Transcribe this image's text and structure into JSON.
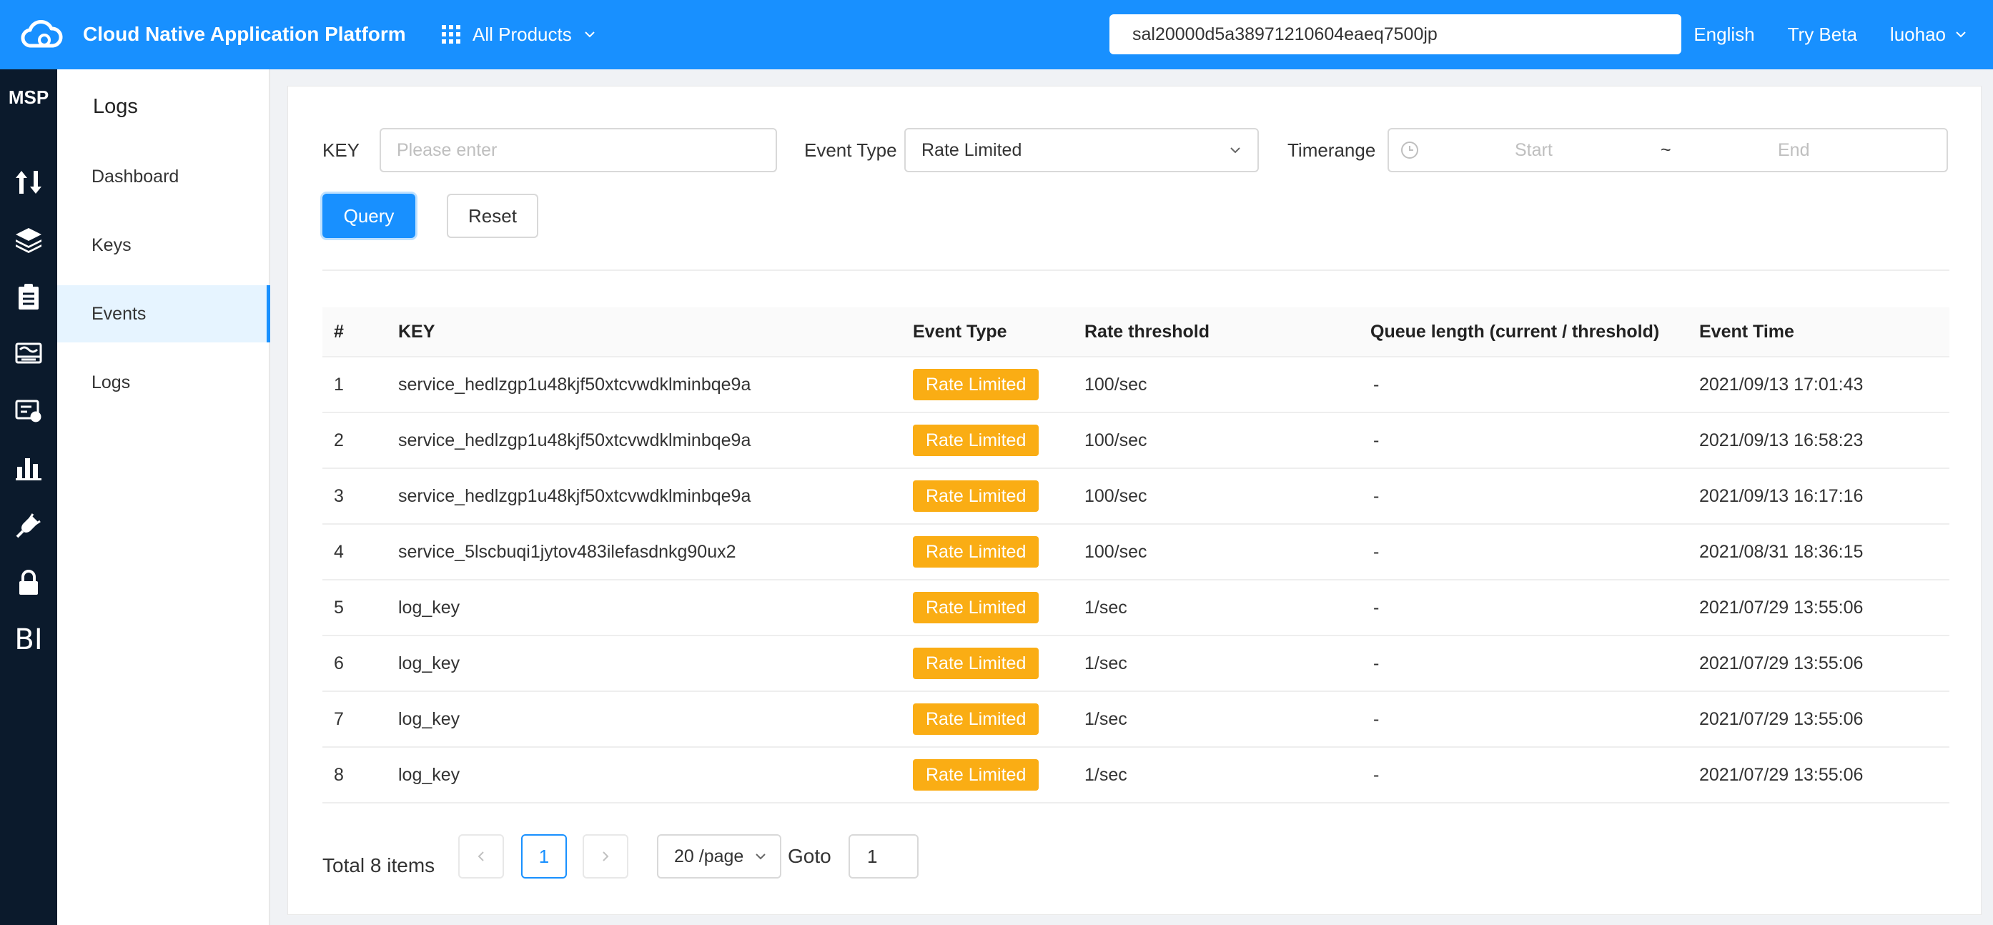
{
  "header": {
    "title": "Cloud Native Application Platform",
    "products_label": "All Products",
    "search_value": "sal20000d5a38971210604eaeq7500jp",
    "language": "English",
    "try_beta": "Try Beta",
    "user": "luohao",
    "brand_color": "#1890ff"
  },
  "rail": {
    "title": "MSP",
    "icons": [
      "transfer-icon",
      "layers-icon",
      "clipboard-icon",
      "monitor-icon",
      "certificate-icon",
      "bar-chart-icon",
      "plug-icon",
      "lock-icon"
    ],
    "bi_label": "BI"
  },
  "submenu": {
    "title": "Logs",
    "items": [
      {
        "label": "Dashboard"
      },
      {
        "label": "Keys"
      },
      {
        "label": "Events"
      },
      {
        "label": "Logs"
      }
    ],
    "active_item": "Events"
  },
  "filters": {
    "key_label": "KEY",
    "key_placeholder": "Please enter",
    "event_type_label": "Event Type",
    "event_type_value": "Rate Limited",
    "timerange_label": "Timerange",
    "start_placeholder": "Start",
    "separator": "~",
    "end_placeholder": "End",
    "query_label": "Query",
    "reset_label": "Reset"
  },
  "table": {
    "headers": [
      "#",
      "KEY",
      "Event Type",
      "Rate threshold",
      "Queue length (current / threshold)",
      "Event Time"
    ],
    "rows": [
      {
        "no": "1",
        "key": "service_hedlzgp1u48kjf50xtcvwdklminbqe9a",
        "type": "Rate Limited",
        "rate": "100/sec",
        "queue": "-",
        "time": "2021/09/13 17:01:43"
      },
      {
        "no": "2",
        "key": "service_hedlzgp1u48kjf50xtcvwdklminbqe9a",
        "type": "Rate Limited",
        "rate": "100/sec",
        "queue": "-",
        "time": "2021/09/13 16:58:23"
      },
      {
        "no": "3",
        "key": "service_hedlzgp1u48kjf50xtcvwdklminbqe9a",
        "type": "Rate Limited",
        "rate": "100/sec",
        "queue": "-",
        "time": "2021/09/13 16:17:16"
      },
      {
        "no": "4",
        "key": "service_5lscbuqi1jytov483ilefasdnkg90ux2",
        "type": "Rate Limited",
        "rate": "100/sec",
        "queue": "-",
        "time": "2021/08/31 18:36:15"
      },
      {
        "no": "5",
        "key": "log_key",
        "type": "Rate Limited",
        "rate": "1/sec",
        "queue": "-",
        "time": "2021/07/29 13:55:06"
      },
      {
        "no": "6",
        "key": "log_key",
        "type": "Rate Limited",
        "rate": "1/sec",
        "queue": "-",
        "time": "2021/07/29 13:55:06"
      },
      {
        "no": "7",
        "key": "log_key",
        "type": "Rate Limited",
        "rate": "1/sec",
        "queue": "-",
        "time": "2021/07/29 13:55:06"
      },
      {
        "no": "8",
        "key": "log_key",
        "type": "Rate Limited",
        "rate": "1/sec",
        "queue": "-",
        "time": "2021/07/29 13:55:06"
      }
    ],
    "tag_color": "#faad14"
  },
  "pagination": {
    "total": "Total 8 items",
    "current_page": "1",
    "page_size": "20 /page",
    "goto_label": "Goto",
    "goto_value": "1"
  }
}
